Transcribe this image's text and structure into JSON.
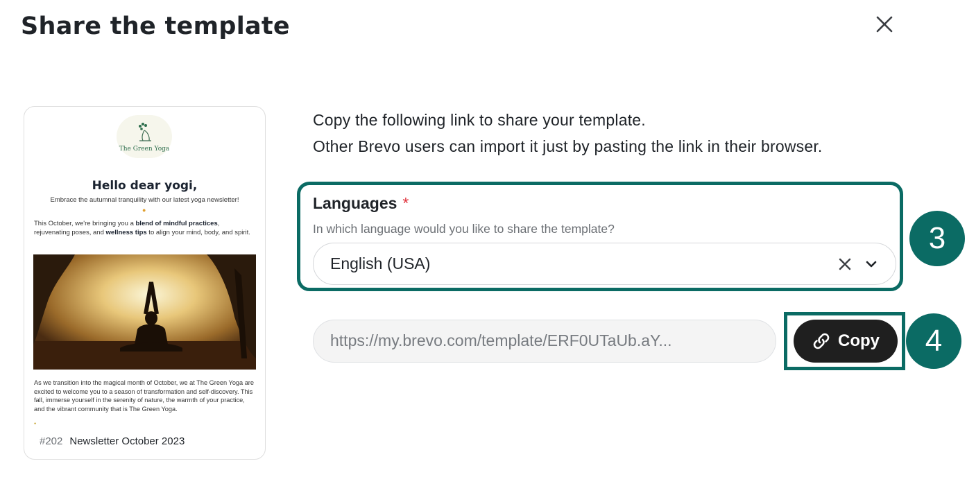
{
  "dialog": {
    "title": "Share the template",
    "close_icon": "close-icon"
  },
  "template_card": {
    "logo_text": "The Green Yoga",
    "heading": "Hello dear yogi,",
    "subheading": "Embrace the autumnal tranquility with our latest yoga newsletter!",
    "para1_a": "This October, we're bringing you a ",
    "para1_b": "blend of mindful practices",
    "para1_c": ", rejuvenating poses, and ",
    "para1_d": "wellness tips",
    "para1_e": " to align your mind, body, and spirit.",
    "para2": "As we transition into the magical month of October, we at The Green Yoga are excited to welcome you to a season of transformation and self-discovery. This fall, immerse yourself in the serenity of nature, the warmth of your practice, and the vibrant community that is The Green Yoga.",
    "id": "#202",
    "name": "Newsletter October 2023"
  },
  "share": {
    "line1": "Copy the following link to share your template.",
    "line2": "Other Brevo users can import it just by pasting the link in their browser."
  },
  "languages": {
    "label": "Languages",
    "required_mark": "*",
    "help": "In which language would you like to share the template?",
    "selected": "English (USA)"
  },
  "link": {
    "value": "https://my.brevo.com/template/ERF0UTaUb.aY..."
  },
  "copy_button": {
    "label": "Copy",
    "icon": "link-icon"
  },
  "annotations": {
    "step3": "3",
    "step4": "4"
  },
  "colors": {
    "accent": "#0b6b64",
    "button_bg": "#1f1f1f",
    "required": "#e0303a"
  }
}
